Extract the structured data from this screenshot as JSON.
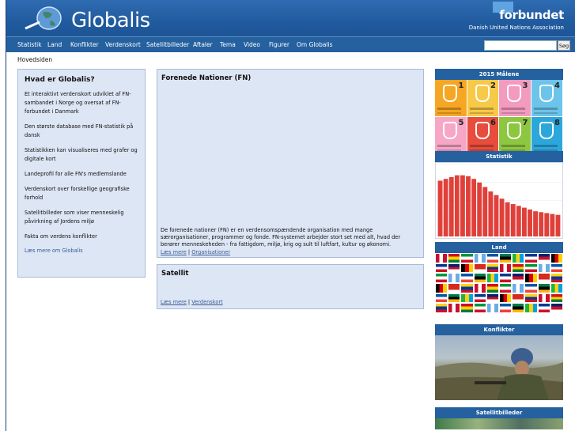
{
  "header": {
    "logo_text": "Globalis",
    "partner_title": "forbundet",
    "partner_subtitle": "Danish United Nations Association"
  },
  "nav": {
    "items": [
      "Statistik",
      "Land",
      "Konflikter",
      "Verdenskort",
      "Satellitbilleder",
      "Aftaler",
      "Tema",
      "Video",
      "Figurer",
      "Om Globalis"
    ],
    "search_placeholder": "",
    "search_button": "Søg"
  },
  "breadcrumb": "Hovedsiden",
  "sidebar": {
    "title": "Hvad er Globalis?",
    "paragraphs": [
      "Et interaktivt verdenskort udviklet af FN-sambandet i Norge og oversat af FN-forbundet i Danmark",
      "Den største database med FN-statistik på dansk",
      "Statistikken kan visualiseres med grafer og digitale kort",
      "Landeprofil for alle FN's medlemslande",
      "Verdenskort over forskellige geografiske forhold",
      "Satellitbilleder som viser menneskelig påvirkning af Jordens miljø",
      "Fakta om verdens konflikter"
    ],
    "more_link": "Læs mere om Globalis"
  },
  "main": {
    "fn_box": {
      "title": "Forenede Nationer (FN)",
      "description": "De forenede nationer (FN) er en verdensomspændende organisation med mange særorganisationer, programmer og fonde. FN-systemet arbejder stort set med alt, hvad der berører menneskeheden - fra fattigdom, miljø, krig og sult til luftfart, kultur og økonomi.",
      "link_more": "Læs mere",
      "link_other": "Organisationer"
    },
    "sat_box": {
      "title": "Satellit",
      "link_more": "Læs mere",
      "link_other": "Verdenskort"
    }
  },
  "right": {
    "mdg": {
      "title": "2015 Målene",
      "goals": [
        {
          "num": "1",
          "color": "#f5a623"
        },
        {
          "num": "2",
          "color": "#f7c948"
        },
        {
          "num": "3",
          "color": "#f29bbf"
        },
        {
          "num": "4",
          "color": "#6cc4ea"
        },
        {
          "num": "5",
          "color": "#f7a6c6"
        },
        {
          "num": "6",
          "color": "#e74c3c"
        },
        {
          "num": "7",
          "color": "#8dc63f"
        },
        {
          "num": "8",
          "color": "#2ba7dc"
        }
      ]
    },
    "statistik": {
      "title": "Statistik"
    },
    "land": {
      "title": "Land"
    },
    "konflikter": {
      "title": "Konflikter"
    },
    "satellitbilleder": {
      "title": "Satellitbilleder"
    }
  },
  "chart_data": {
    "type": "bar",
    "values": [
      62,
      64,
      66,
      68,
      68,
      67,
      64,
      60,
      55,
      50,
      46,
      42,
      38,
      36,
      34,
      32,
      30,
      28,
      27,
      26,
      25,
      24
    ],
    "color": "#e0403a",
    "ylim": [
      0,
      80
    ],
    "grid": true
  }
}
